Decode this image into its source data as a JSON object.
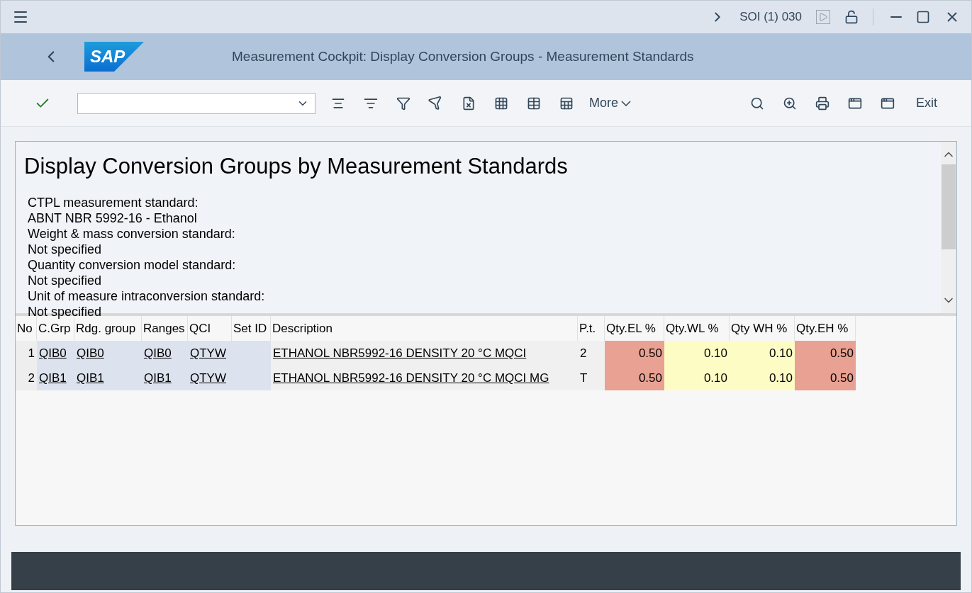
{
  "topbar": {
    "system": "SOI (1) 030"
  },
  "header": {
    "logo": "SAP",
    "title": "Measurement Cockpit: Display Conversion Groups - Measurement Standards"
  },
  "toolbar": {
    "more": "More",
    "exit": "Exit"
  },
  "report": {
    "heading": "Display Conversion Groups by Measurement Standards",
    "lines": [
      "CTPL measurement standard:",
      "ABNT NBR 5992-16 - Ethanol",
      "Weight & mass conversion standard:",
      "Not specified",
      "Quantity conversion model standard:",
      "Not specified",
      "Unit of measure intraconversion standard:",
      "Not specified"
    ]
  },
  "table": {
    "columns": [
      {
        "label": "No",
        "kind": "number",
        "color": "#eeeeee"
      },
      {
        "label": "C.Grp",
        "kind": "link",
        "color": "#dde3ee"
      },
      {
        "label": "Rdg. group",
        "kind": "link",
        "color": "#dde3ee"
      },
      {
        "label": "Ranges",
        "kind": "link",
        "color": "#dde3ee"
      },
      {
        "label": "QCI",
        "kind": "link",
        "color": "#dde3ee"
      },
      {
        "label": "Set ID",
        "kind": "text",
        "color": "#dde3ee"
      },
      {
        "label": "Description",
        "kind": "link",
        "color": "#f0f0f0"
      },
      {
        "label": "P.t.",
        "kind": "text",
        "color": "#f0f0f0"
      },
      {
        "label": "Qty.EL %",
        "kind": "number",
        "color": "#e8a192"
      },
      {
        "label": "Qty.WL %",
        "kind": "number",
        "color": "#fdfcc4"
      },
      {
        "label": "Qty WH %",
        "kind": "number",
        "color": "#fdfcc4"
      },
      {
        "label": "Qty.EH %",
        "kind": "number",
        "color": "#e8a192"
      }
    ],
    "rows": [
      [
        "1",
        "QIB0",
        "QIB0",
        "QIB0",
        "QTYW",
        null,
        "ETHANOL NBR5992-16 DENSITY 20 °C MQCI",
        "2",
        "0.50",
        "0.10",
        "0.10",
        "0.50"
      ],
      [
        "2",
        "QIB1",
        "QIB1",
        "QIB1",
        "QTYW",
        null,
        "ETHANOL NBR5992-16 DENSITY 20 °C MQCI MG",
        "T",
        "0.50",
        "0.10",
        "0.10",
        "0.50"
      ]
    ]
  }
}
